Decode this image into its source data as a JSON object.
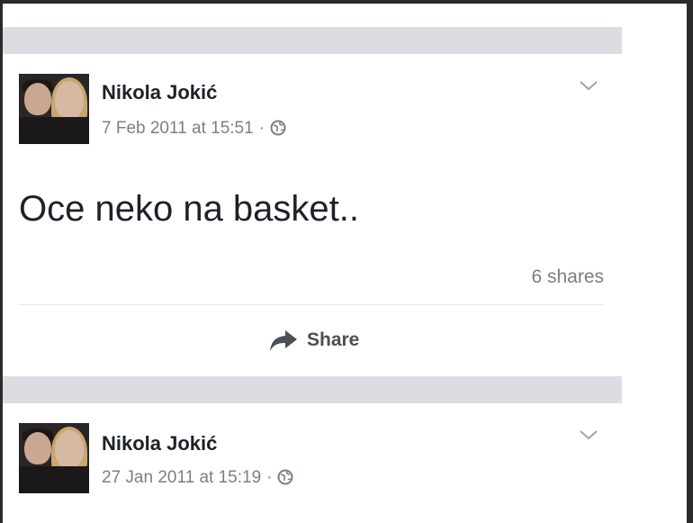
{
  "posts": [
    {
      "author": "Nikola Jokić",
      "timestamp": "7 Feb 2011 at 15:51",
      "separator": "·",
      "privacy_icon": "globe-icon",
      "menu_icon": "chevron-down-icon",
      "text": "Oce neko na basket..",
      "shares": "6 shares",
      "share_label": "Share",
      "share_icon": "share-arrow-icon"
    },
    {
      "author": "Nikola Jokić",
      "timestamp": "27 Jan 2011 at 15:19",
      "separator": "·",
      "privacy_icon": "globe-icon",
      "menu_icon": "chevron-down-icon"
    }
  ],
  "colors": {
    "background": "#ffffff",
    "separator": "#dcdde2",
    "name": "#1d2129",
    "meta": "#7a7f87",
    "share": "#4b4f56"
  }
}
